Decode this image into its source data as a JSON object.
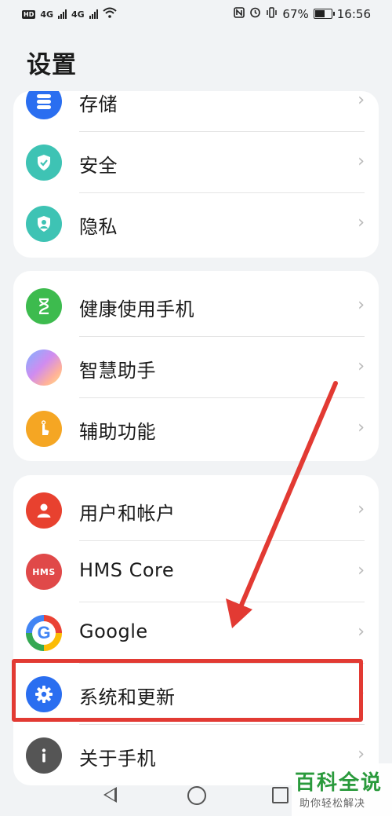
{
  "status_bar": {
    "network_labels": [
      "HD",
      "4G",
      "4G"
    ],
    "battery_percent_text": "67%",
    "battery_level": 0.67,
    "time": "16:56",
    "icons": [
      "nfc-icon",
      "alarm-icon",
      "vibrate-icon"
    ]
  },
  "page": {
    "title": "设置"
  },
  "groups": [
    {
      "items": [
        {
          "label": "存储",
          "icon": "storage-icon",
          "color": "#2a6ef0"
        },
        {
          "label": "安全",
          "icon": "shield-icon",
          "color": "#3ec3b4"
        },
        {
          "label": "隐私",
          "icon": "privacy-icon",
          "color": "#3ec3b4"
        }
      ]
    },
    {
      "items": [
        {
          "label": "健康使用手机",
          "icon": "hourglass-icon",
          "color": "#3dbb4e"
        },
        {
          "label": "智慧助手",
          "icon": "assistant-icon",
          "color": "#b78cf0"
        },
        {
          "label": "辅助功能",
          "icon": "accessibility-icon",
          "color": "#f5a623"
        }
      ]
    },
    {
      "items": [
        {
          "label": "用户和帐户",
          "icon": "user-icon",
          "color": "#e8412f"
        },
        {
          "label": "HMS Core",
          "icon": "hms-icon",
          "color": "#e04949",
          "icon_text": "HMS"
        },
        {
          "label": "Google",
          "icon": "google-icon",
          "color": "#ffffff"
        },
        {
          "label": "系统和更新",
          "icon": "gear-icon",
          "color": "#2a6ef0"
        },
        {
          "label": "关于手机",
          "icon": "info-icon",
          "color": "#555555"
        }
      ]
    }
  ],
  "annotation": {
    "color": "#e23a33"
  },
  "watermark": {
    "title": "百科全说",
    "subtitle": "助你轻松解决"
  }
}
